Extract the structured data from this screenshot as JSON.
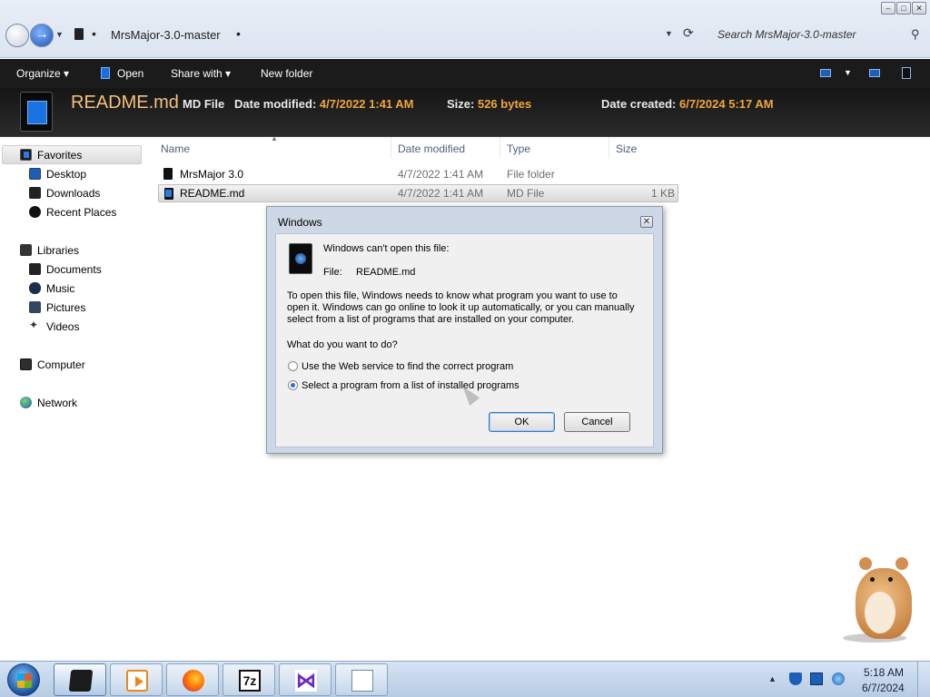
{
  "window": {
    "address": "MrsMajor-3.0-master",
    "search_placeholder": "Search MrsMajor-3.0-master"
  },
  "toolbar": {
    "organize": "Organize",
    "open": "Open",
    "share_with": "Share with",
    "new_folder": "New folder"
  },
  "details": {
    "name": "README.md",
    "type": "MD File",
    "date_modified_label": "Date modified:",
    "date_modified": "4/7/2022 1:41 AM",
    "size_label": "Size:",
    "size": "526 bytes",
    "date_created_label": "Date created:",
    "date_created": "6/7/2024 5:17 AM"
  },
  "sidebar": {
    "favorites": "Favorites",
    "desktop": "Desktop",
    "downloads": "Downloads",
    "recent_places": "Recent Places",
    "libraries": "Libraries",
    "documents": "Documents",
    "music": "Music",
    "pictures": "Pictures",
    "videos": "Videos",
    "computer": "Computer",
    "network": "Network"
  },
  "columns": {
    "name": "Name",
    "date_modified": "Date modified",
    "type": "Type",
    "size": "Size"
  },
  "files": [
    {
      "name": "MrsMajor 3.0",
      "date_modified": "4/7/2022 1:41 AM",
      "type": "File folder",
      "size": ""
    },
    {
      "name": "README.md",
      "date_modified": "4/7/2022 1:41 AM",
      "type": "MD File",
      "size": "1 KB"
    }
  ],
  "dialog": {
    "title": "Windows",
    "heading": "Windows can't open this file:",
    "file_label": "File:",
    "file_name": "README.md",
    "description_1": "To open this file, Windows needs to know what program you want to use to",
    "description_2": "open it. Windows can go online to look it up automatically, or you can manually",
    "description_3": "select from a list of programs that are installed on your computer.",
    "question": "What do you want to do?",
    "option_web": "Use the Web service to find the correct program",
    "option_list": "Select a program from a list of installed programs",
    "selected_option": "option_list",
    "ok": "OK",
    "cancel": "Cancel"
  },
  "taskbar": {
    "apps": [
      "explorer",
      "media-player",
      "firefox",
      "7-zip",
      "visual-studio",
      "notepad"
    ],
    "clock_time": "5:18 AM",
    "clock_date": "6/7/2024"
  }
}
